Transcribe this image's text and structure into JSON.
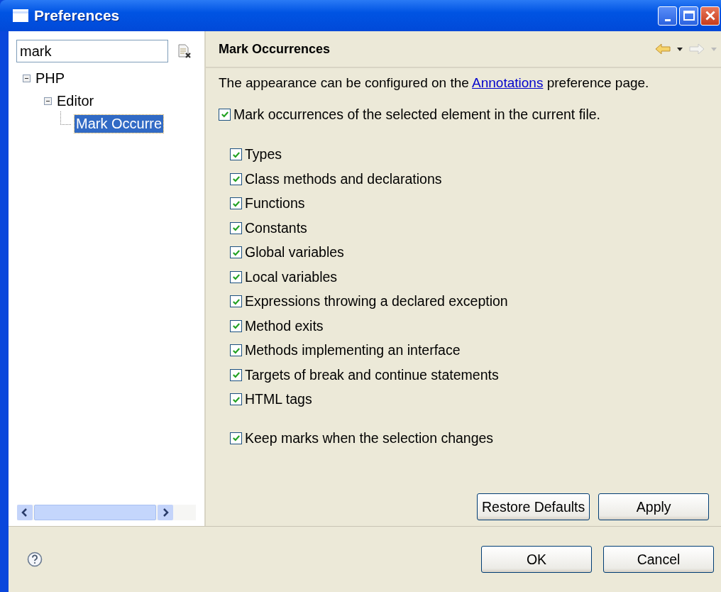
{
  "window": {
    "title": "Preferences"
  },
  "filter": {
    "value": "mark"
  },
  "tree": [
    {
      "label": "PHP",
      "expanded": true,
      "selected": false,
      "children": [
        {
          "label": "Editor",
          "expanded": true,
          "selected": false,
          "children": [
            {
              "label": "Mark Occurre",
              "selected": true
            }
          ]
        }
      ]
    }
  ],
  "page": {
    "title": "Mark Occurrences",
    "intro_before": "The appearance can be configured on the",
    "intro_link": "Annotations",
    "intro_after": "preference page.",
    "main_option": {
      "label": "Mark occurrences of the selected element in the current file.",
      "checked": true
    },
    "options": [
      {
        "label": "Types",
        "checked": true
      },
      {
        "label": "Class methods and declarations",
        "checked": true
      },
      {
        "label": "Functions",
        "checked": true
      },
      {
        "label": "Constants",
        "checked": true
      },
      {
        "label": "Global variables",
        "checked": true
      },
      {
        "label": "Local variables",
        "checked": true
      },
      {
        "label": "Expressions throwing a declared exception",
        "checked": true
      },
      {
        "label": "Method exits",
        "checked": true
      },
      {
        "label": "Methods implementing an interface",
        "checked": true
      },
      {
        "label": "Targets of break and continue statements",
        "checked": true
      },
      {
        "label": "HTML tags",
        "checked": true
      }
    ],
    "keep_option": {
      "label": "Keep marks when the selection changes",
      "checked": true
    },
    "buttons": [
      "Restore Defaults",
      "Apply"
    ]
  },
  "footer_buttons": [
    "OK",
    "Cancel"
  ]
}
